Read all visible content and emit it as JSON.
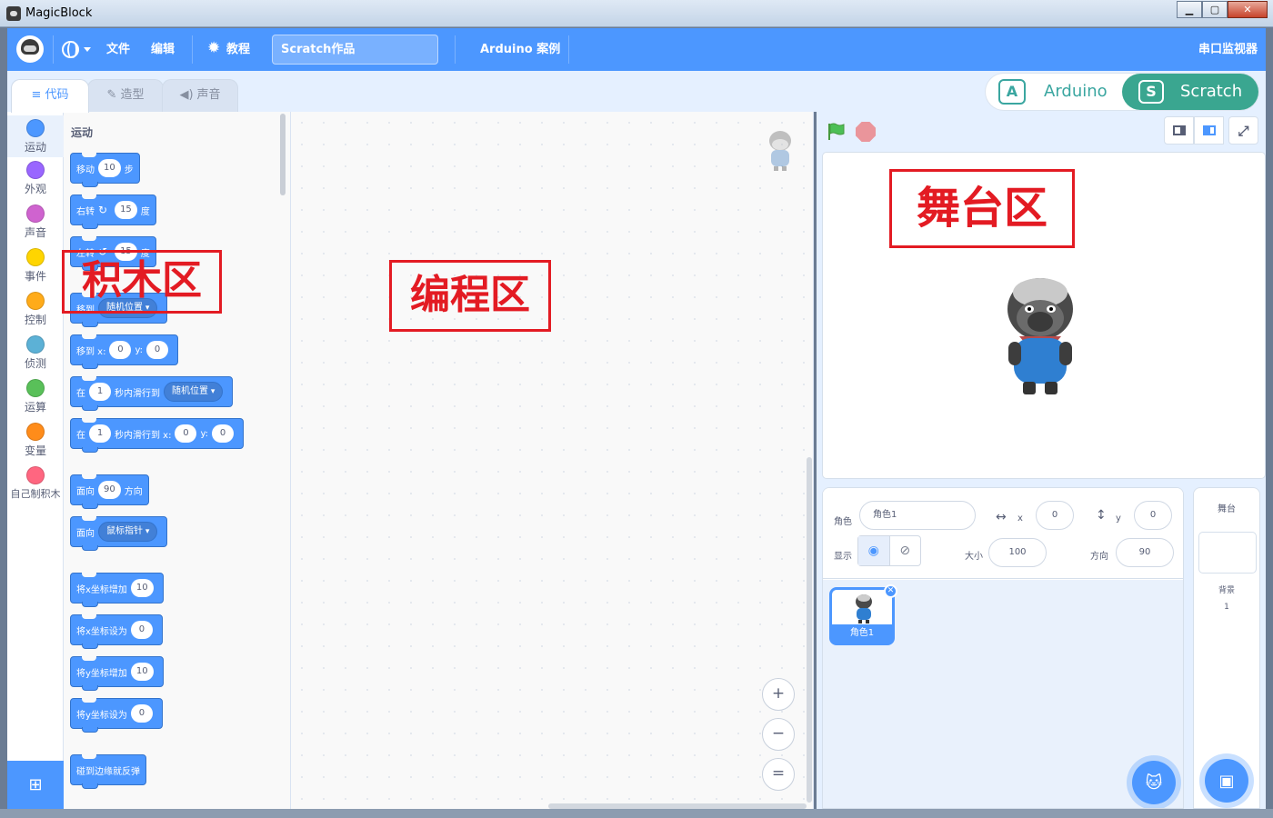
{
  "window": {
    "title": "MagicBlock",
    "minimize": "▁",
    "maximize": "▢",
    "close": "✕"
  },
  "menubar": {
    "file": "文件",
    "edit": "编辑",
    "tutorials": "教程",
    "project_title": "Scratch作品",
    "arduino_examples": "Arduino 案例",
    "serial_monitor": "串口监视器"
  },
  "tabs": [
    {
      "label": "代码",
      "icon": "code-icon"
    },
    {
      "label": "造型",
      "icon": "brush-icon"
    },
    {
      "label": "声音",
      "icon": "speaker-icon"
    }
  ],
  "mode_switch": {
    "arduino": "Arduino",
    "arduino_logo": "A",
    "scratch": "Scratch",
    "scratch_logo": "S"
  },
  "categories": [
    {
      "label": "运动",
      "color": "#4c97ff"
    },
    {
      "label": "外观",
      "color": "#9966ff"
    },
    {
      "label": "声音",
      "color": "#cf63cf"
    },
    {
      "label": "事件",
      "color": "#ffd500"
    },
    {
      "label": "控制",
      "color": "#ffab19"
    },
    {
      "label": "侦测",
      "color": "#5cb1d6"
    },
    {
      "label": "运算",
      "color": "#59c059"
    },
    {
      "label": "变量",
      "color": "#ff8c1a"
    },
    {
      "label": "自己制积木",
      "color": "#ff6680"
    }
  ],
  "palette": {
    "title": "运动",
    "blocks": {
      "move": {
        "a": "移动",
        "n": "10",
        "b": "步"
      },
      "turn_right": {
        "a": "右转",
        "n": "15",
        "b": "度"
      },
      "turn_left": {
        "a": "左转",
        "n": "15",
        "b": "度"
      },
      "goto": {
        "a": "移到",
        "dd": "随机位置"
      },
      "goto_xy": {
        "a": "移到 x:",
        "x": "0",
        "b": "y:",
        "y": "0"
      },
      "glide_to": {
        "a": "在",
        "n": "1",
        "b": "秒内滑行到",
        "dd": "随机位置"
      },
      "glide_xy": {
        "a": "在",
        "n": "1",
        "b": "秒内滑行到 x:",
        "x": "0",
        "c": "y:",
        "y": "0"
      },
      "point_dir": {
        "a": "面向",
        "n": "90",
        "b": "方向"
      },
      "point_towards": {
        "a": "面向",
        "dd": "鼠标指针"
      },
      "change_x": {
        "a": "将x坐标增加",
        "n": "10"
      },
      "set_x": {
        "a": "将x坐标设为",
        "n": "0"
      },
      "change_y": {
        "a": "将y坐标增加",
        "n": "10"
      },
      "set_y": {
        "a": "将y坐标设为",
        "n": "0"
      },
      "bounce": {
        "a": "碰到边缘就反弹"
      }
    }
  },
  "sprite_info": {
    "sprite_label": "角色",
    "sprite_name": "角色1",
    "x_label": "x",
    "x_value": "0",
    "y_label": "y",
    "y_value": "0",
    "show_label": "显示",
    "size_label": "大小",
    "size_value": "100",
    "direction_label": "方向",
    "direction_value": "90"
  },
  "sprite_list": [
    {
      "name": "角色1"
    }
  ],
  "stage_pane": {
    "title": "舞台",
    "backdrop_label": "背景",
    "backdrop_count": "1"
  },
  "zoom": {
    "in": "+",
    "out": "−",
    "reset": "="
  },
  "annotations": {
    "blocks_area": "积木区",
    "coding_area": "编程区",
    "stage_area": "舞台区"
  },
  "colors": {
    "accent": "#4c97ff",
    "mode_active": "#3aa690",
    "annotation": "#e31b23"
  }
}
